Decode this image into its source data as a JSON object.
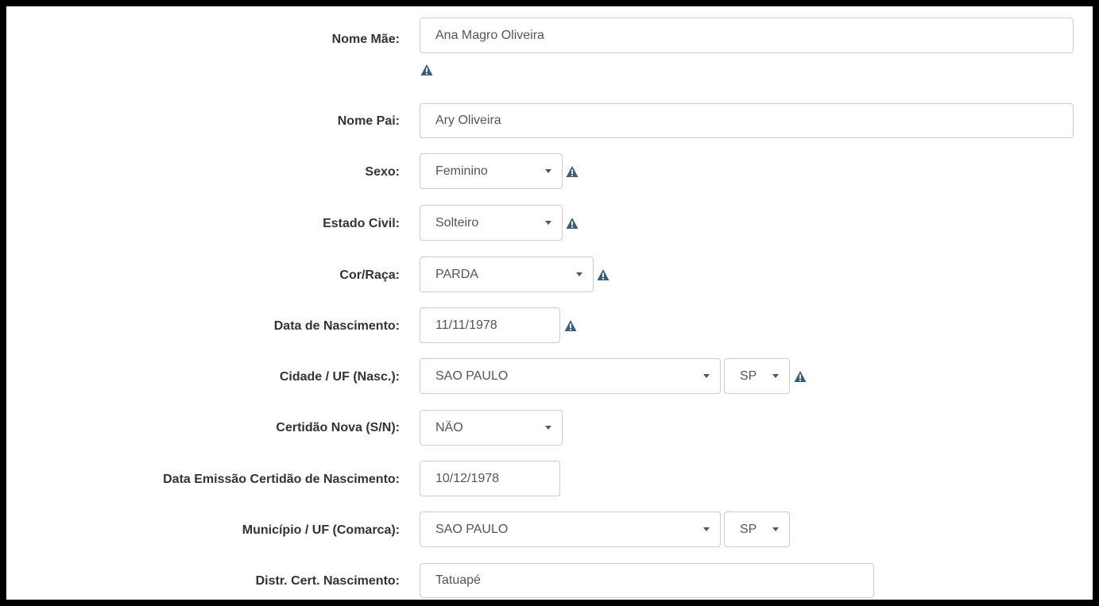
{
  "form": {
    "nome_mae": {
      "label": "Nome Mãe:",
      "value": "Ana Magro Oliveira"
    },
    "nome_pai": {
      "label": "Nome Pai:",
      "value": "Ary Oliveira"
    },
    "sexo": {
      "label": "Sexo:",
      "value": "Feminino"
    },
    "estado_civil": {
      "label": "Estado Civil:",
      "value": "Solteiro"
    },
    "cor_raca": {
      "label": "Cor/Raça:",
      "value": "PARDA"
    },
    "data_nascimento": {
      "label": "Data de Nascimento:",
      "value": "11/11/1978"
    },
    "cidade_uf_nasc": {
      "label": "Cidade / UF (Nasc.):",
      "cidade": "SAO PAULO",
      "uf": "SP"
    },
    "certidao_nova": {
      "label": "Certidão Nova (S/N):",
      "value": "NÃO"
    },
    "data_emissao_certidao": {
      "label": "Data Emissão Certidão de Nascimento:",
      "value": "10/12/1978"
    },
    "municipio_uf_comarca": {
      "label": "Município / UF (Comarca):",
      "municipio": "SAO PAULO",
      "uf": "SP"
    },
    "distr_cert_nascimento": {
      "label": "Distr. Cert. Nascimento:",
      "value": "Tatuapé"
    }
  },
  "colors": {
    "warning_icon": "#3a5f7a",
    "input_border": "#cccccc",
    "label_text": "#333333",
    "value_text": "#555555"
  },
  "icons": {
    "warning": "warning-triangle-icon",
    "dropdown": "caret-down-icon"
  }
}
